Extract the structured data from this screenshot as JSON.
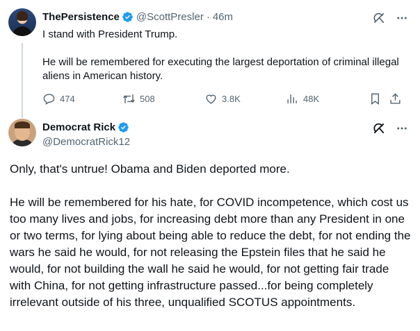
{
  "parent_tweet": {
    "display_name": "ThePersistence",
    "handle": "@ScottPresler",
    "separator": "·",
    "time": "46m",
    "paragraphs": [
      "I stand with President Trump.",
      "He will be remembered for executing the largest deportation of criminal illegal aliens in American history."
    ],
    "actions": {
      "replies": "474",
      "reposts": "508",
      "likes": "3.8K",
      "views": "48K"
    }
  },
  "reply_tweet": {
    "display_name": "Democrat Rick",
    "handle": "@DemocratRick12",
    "paragraphs": [
      "Only, that's untrue! Obama and Biden deported more.",
      "He will be remembered for his hate, for COVID incompetence, which cost us too many lives and jobs, for increasing debt more than any President in one or two terms, for lying about being able to reduce the debt, for not ending the wars he said he would, for not releasing the Epstein files that he said he would, for not building the wall he said he would, for not getting fair trade with China, for not getting infrastructure passed...for being completely irrelevant outside of his three, unqualified SCOTUS appointments."
    ]
  },
  "colors": {
    "text": "#0f1419",
    "secondary": "#536471",
    "verified": "#1d9bf0",
    "thread_line": "#cfd9de"
  },
  "icons": [
    "grok-icon",
    "more-icon",
    "reply-icon",
    "repost-icon",
    "like-icon",
    "views-icon",
    "bookmark-icon",
    "share-icon",
    "verified-badge-icon"
  ]
}
